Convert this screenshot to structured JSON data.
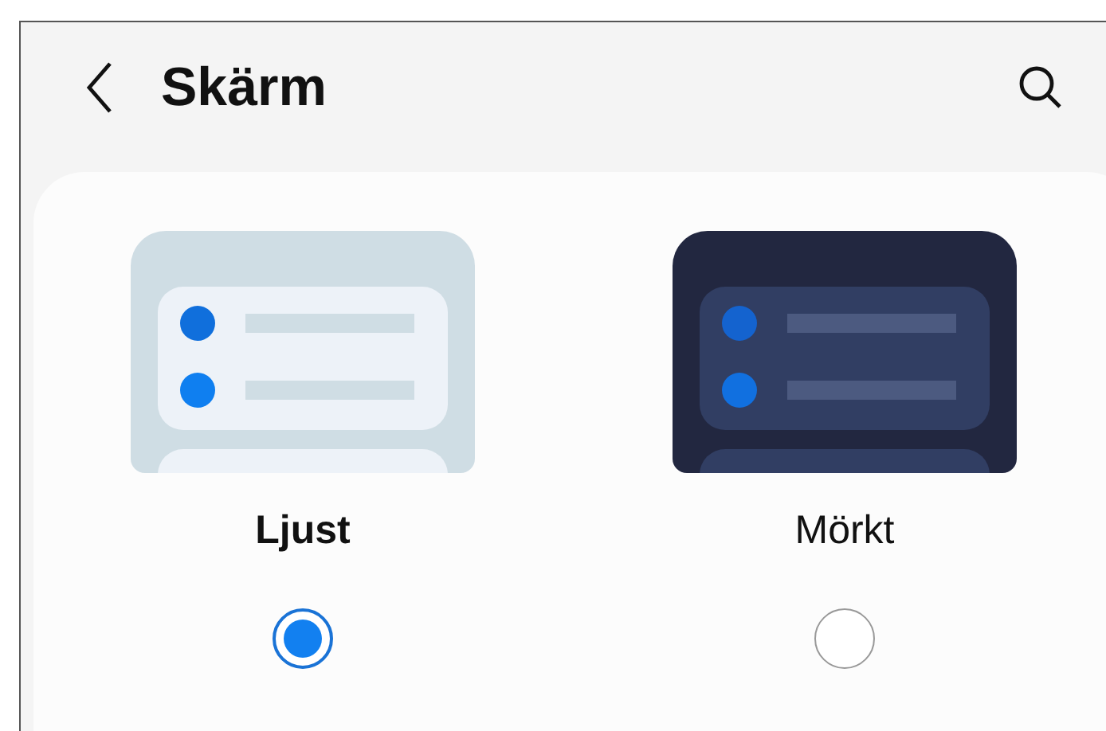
{
  "header": {
    "title": "Skärm"
  },
  "themes": [
    {
      "kind": "light",
      "label": "Ljust",
      "selected": true
    },
    {
      "kind": "dark",
      "label": "Mörkt",
      "selected": false
    }
  ]
}
